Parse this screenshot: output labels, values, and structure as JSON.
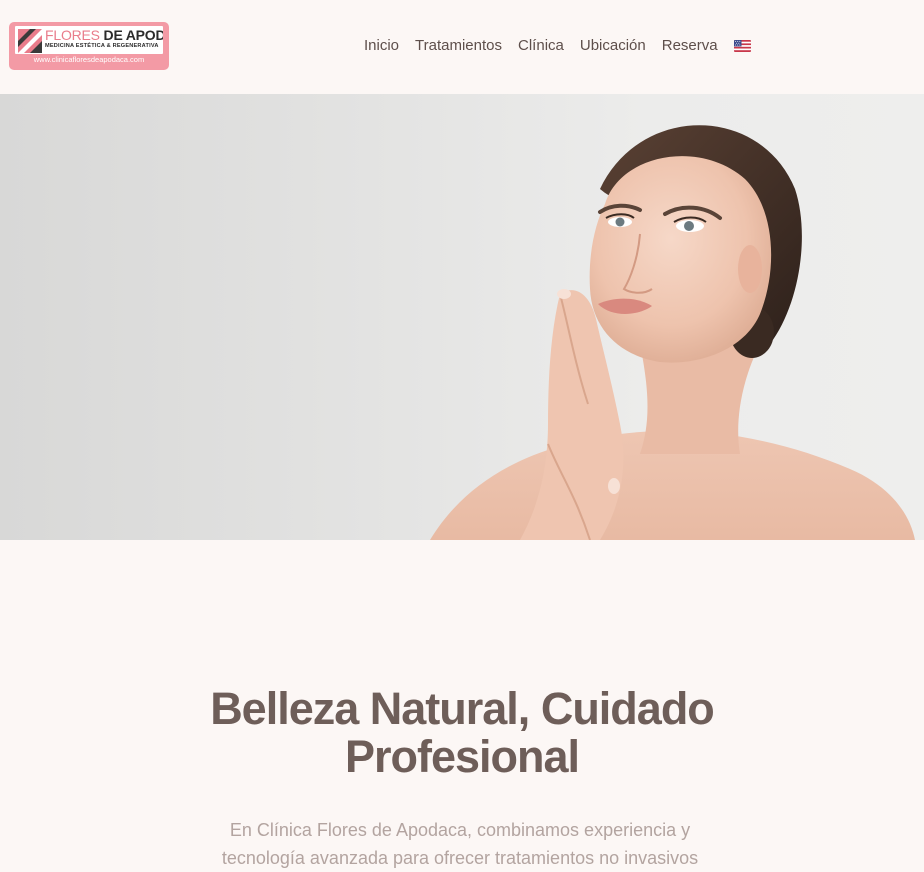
{
  "brand": {
    "name_part1": "FLORES",
    "name_part2": "DE APODACA",
    "tagline": "MEDICINA ESTÉTICA & REGENERATIVA",
    "url": "www.clinicafloresdeapodaca.com"
  },
  "nav": {
    "items": [
      {
        "label": "Inicio"
      },
      {
        "label": "Tratamientos"
      },
      {
        "label": "Clínica"
      },
      {
        "label": "Ubicación"
      },
      {
        "label": "Reserva"
      }
    ],
    "language_icon": "us-flag-icon"
  },
  "hero": {
    "image": "woman-touching-face-photo"
  },
  "intro_section": {
    "heading_line1": "Belleza Natural, Cuidado",
    "heading_line2": "Profesional",
    "body_line1": "En Clínica Flores de Apodaca, combinamos experiencia y",
    "body_line2": "tecnología avanzada para ofrecer tratamientos no invasivos"
  },
  "colors": {
    "background": "#fcf7f5",
    "logo_pink": "#f39aa5",
    "heading": "#6e5e59",
    "body_text": "#b3a4a0"
  }
}
